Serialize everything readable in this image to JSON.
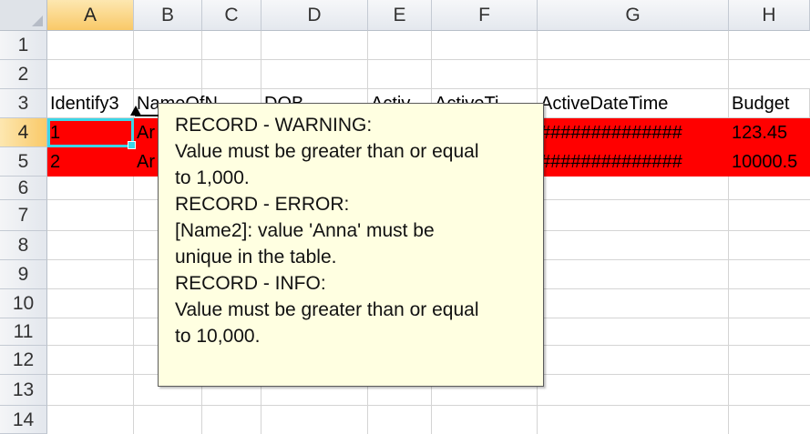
{
  "columns": [
    "A",
    "B",
    "C",
    "D",
    "E",
    "F",
    "G",
    "H"
  ],
  "rows": [
    "1",
    "2",
    "3",
    "4",
    "5",
    "6",
    "7",
    "8",
    "9",
    "10",
    "11",
    "12",
    "13",
    "14"
  ],
  "selected_column": "A",
  "selected_row": "4",
  "colors": {
    "error_fill": "#ff0000",
    "active_border": "#3dd6e6",
    "comment_bg": "#ffffe1"
  },
  "cells": {
    "A3": "Identify3",
    "B3": "NameOfN",
    "D3": "DOB",
    "E3": "Activ",
    "F3": "ActiveTi",
    "G3": "ActiveDateTime",
    "H3": "Budget",
    "A4": "1",
    "B4": "Ar",
    "G4": "##############",
    "H4": "123.45",
    "A5": "2",
    "B5": "Ar",
    "G5": "##############",
    "H5": "10000.5"
  },
  "comment": {
    "lines": [
      "RECORD - WARNING:",
      "Value must be greater than or equal",
      "to 1,000.",
      "RECORD - ERROR:",
      "[Name2]: value 'Anna' must be",
      "unique in the table.",
      "RECORD - INFO:",
      "Value must be greater than or equal",
      "to 10,000."
    ]
  }
}
